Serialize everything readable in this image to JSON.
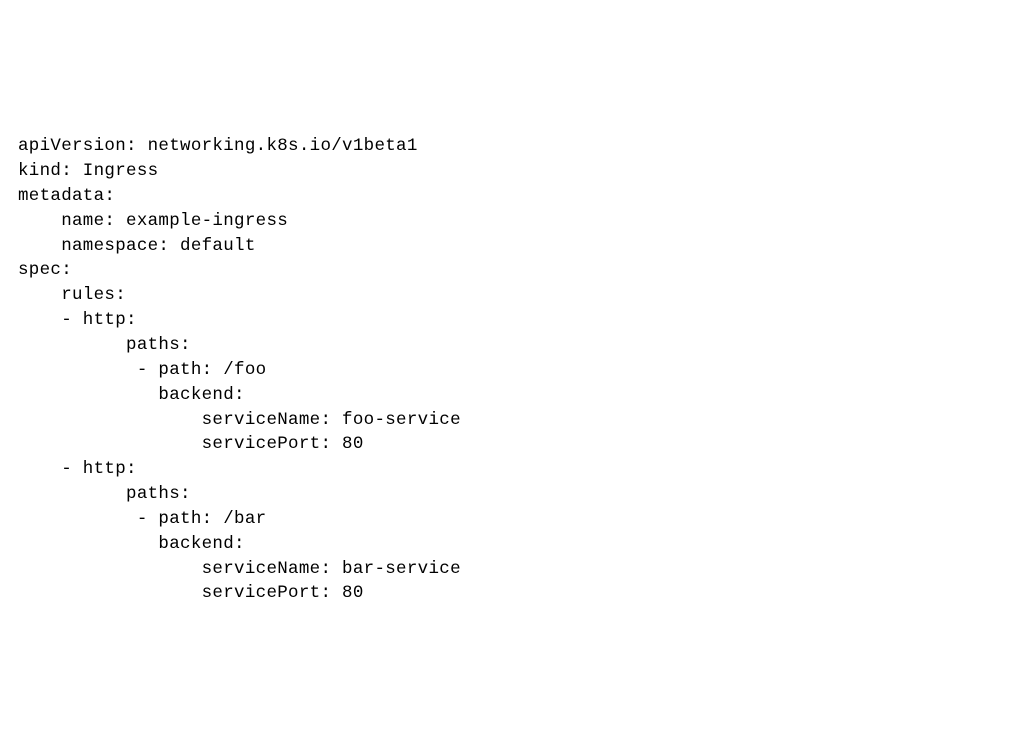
{
  "code": {
    "apiVersion": "apiVersion: networking.k8s.io/v1beta1",
    "kind": "kind: Ingress",
    "metadata": "metadata:",
    "metadata_name": "    name: example-ingress",
    "metadata_namespace": "    namespace: default",
    "spec": "spec:",
    "rules": "    rules:",
    "http1": "    - http:",
    "paths1": "          paths:",
    "path1": "           - path: /foo",
    "backend1": "             backend:",
    "serviceName1": "                 serviceName: foo-service",
    "servicePort1": "                 servicePort: 80",
    "http2": "    - http:",
    "paths2": "          paths:",
    "path2": "           - path: /bar",
    "backend2": "             backend:",
    "serviceName2": "                 serviceName: bar-service",
    "servicePort2": "                 servicePort: 80"
  }
}
